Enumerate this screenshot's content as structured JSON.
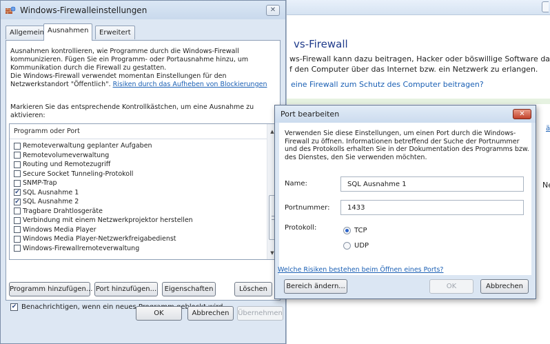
{
  "background": {
    "heading": "vs-Firewall",
    "text_lines": [
      "ws-Firewall kann dazu beitragen, Hacker oder böswillige Software daran zu",
      "f den Computer über das Internet bzw. ein Netzwerk zu erlangen."
    ],
    "link": "eine Firewall zum Schutz des Computer beitragen?",
    "fragment_link": "ä",
    "fragment_text": "Net"
  },
  "window": {
    "title": "Windows-Firewalleinstellungen",
    "close_glyph": "✕"
  },
  "tabs": [
    {
      "label": "Allgemein"
    },
    {
      "label": "Ausnahmen"
    },
    {
      "label": "Erweitert"
    }
  ],
  "exceptions": {
    "description_lines": [
      "Ausnahmen kontrollieren, wie Programme durch die Windows-Firewall",
      "kommunizieren. Fügen Sie ein Programm- oder Portausnahme hinzu, um",
      "Kommunikation durch die Firewall zu gestatten."
    ],
    "location_line1": "Die Windows-Firewall verwendet momentan Einstellungen für den",
    "location_line2": "Netzwerkstandort \"Öffentlich\". ",
    "risk_link": "Risiken durch das Aufheben von Blockierungen",
    "hint_lines": [
      "Markieren Sie das entsprechende Kontrollkästchen, um eine Ausnahme zu",
      "aktivieren:"
    ],
    "list_header": "Programm oder Port",
    "items": [
      {
        "label": "Remoteverwaltung geplanter Aufgaben",
        "checked": false
      },
      {
        "label": "Remotevolumeverwaltung",
        "checked": false
      },
      {
        "label": "Routing und Remotezugriff",
        "checked": false
      },
      {
        "label": "Secure Socket Tunneling-Protokoll",
        "checked": false
      },
      {
        "label": "SNMP-Trap",
        "checked": false
      },
      {
        "label": "SQL Ausnahme 1",
        "checked": true
      },
      {
        "label": "SQL Ausnahme 2",
        "checked": true
      },
      {
        "label": "Tragbare Drahtlosgeräte",
        "checked": false
      },
      {
        "label": "Verbindung mit einem Netzwerkprojektor herstellen",
        "checked": false
      },
      {
        "label": "Windows Media Player",
        "checked": false
      },
      {
        "label": "Windows Media Player-Netzwerkfreigabedienst",
        "checked": false
      },
      {
        "label": "Windows-Firewallremoteverwaltung",
        "checked": false
      }
    ],
    "buttons": {
      "add_program": "Programm hinzufügen...",
      "add_port": "Port hinzufügen...",
      "properties": "Eigenschaften",
      "delete": "Löschen"
    },
    "notify_label": "Benachrichtigen, wenn ein neues Programm geblockt wird",
    "notify_checked": true
  },
  "footer": {
    "ok": "OK",
    "cancel": "Abbrechen",
    "apply": "Übernehmen"
  },
  "dialog": {
    "title": "Port bearbeiten",
    "close_glyph": "✕",
    "description_lines": [
      "Verwenden Sie diese Einstellungen, um einen Port durch die Windows-",
      "Firewall zu öffnen. Informationen betreffend der Suche der Portnummer",
      "und des Protokolls erhalten Sie in der Dokumentation des Programms bzw.",
      "des Dienstes, den Sie verwenden möchten."
    ],
    "name_label": "Name:",
    "name_value": "SQL Ausnahme 1",
    "port_label": "Portnummer:",
    "port_value": "1433",
    "protocol_label": "Protokoll:",
    "protocols": [
      {
        "label": "TCP",
        "selected": true
      },
      {
        "label": "UDP",
        "selected": false
      }
    ],
    "risk_link": "Welche Risiken bestehen beim Öffnen eines Ports?",
    "change_scope": "Bereich ändern...",
    "ok": "OK",
    "cancel": "Abbrechen"
  },
  "colors": {
    "link": "#1a5fb4",
    "window_frame": "#dde7f3",
    "close_red": "#c3412a"
  }
}
